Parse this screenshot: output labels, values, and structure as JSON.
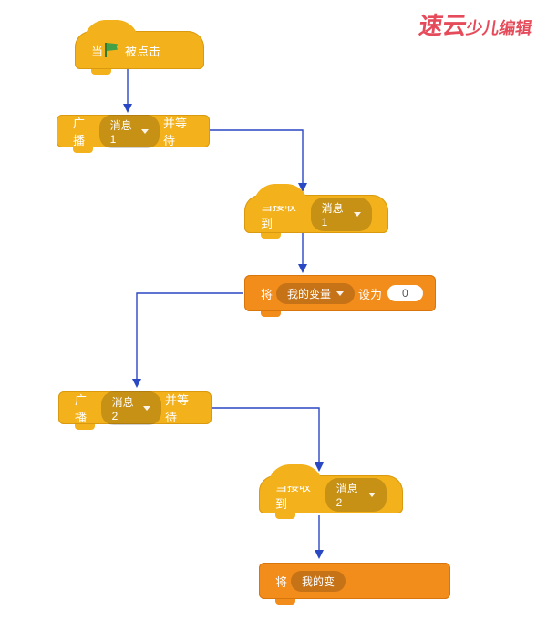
{
  "logo": {
    "main": "速云",
    "sub": "少儿编辑"
  },
  "blocks": {
    "hat1": {
      "prefix": "当",
      "suffix": "被点击"
    },
    "broadcast1": {
      "prefix": "广播",
      "msg": "消息1",
      "suffix": "并等待"
    },
    "receive1": {
      "prefix": "当接收到",
      "msg": "消息1"
    },
    "setvar1": {
      "prefix": "将",
      "var": "我的变量",
      "mid": "设为",
      "val": "0"
    },
    "broadcast2": {
      "prefix": "广播",
      "msg": "消息2",
      "suffix": "并等待"
    },
    "receive2": {
      "prefix": "当接收到",
      "msg": "消息2"
    },
    "setvar2": {
      "prefix": "将",
      "var": "我的变"
    }
  }
}
